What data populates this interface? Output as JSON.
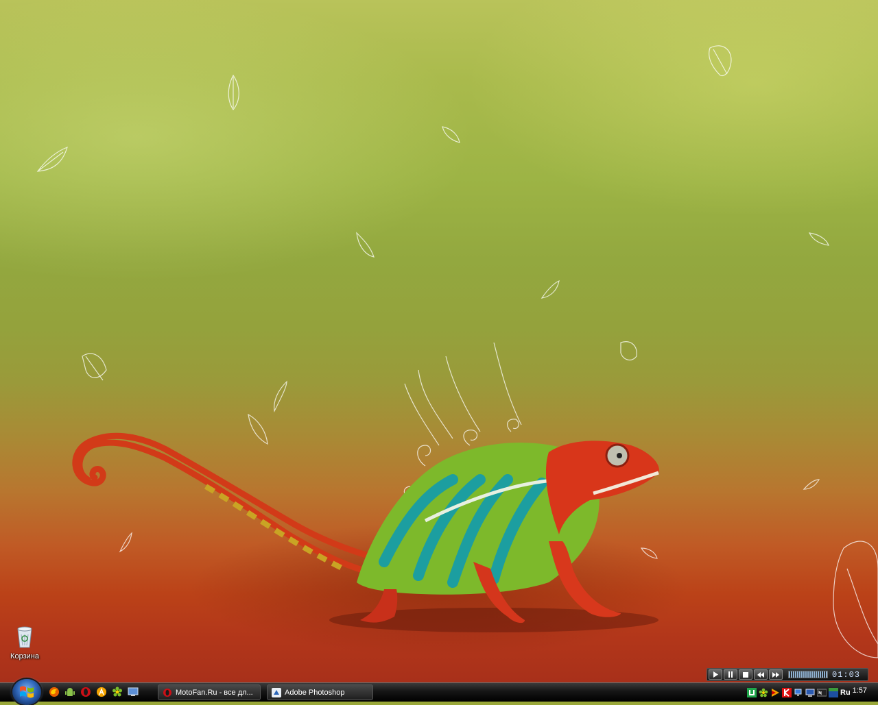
{
  "desktop": {
    "icons": [
      {
        "label": "Корзина",
        "icon": "recycle-bin-icon"
      }
    ]
  },
  "media_player": {
    "buttons": [
      "play-icon",
      "pause-icon",
      "stop-icon",
      "previous-icon",
      "next-icon"
    ],
    "time": "01:03",
    "seek_fraction": 1.0
  },
  "taskbar": {
    "start_icon": "windows-logo-icon",
    "quick_launch": [
      "firefox-icon",
      "android-icon",
      "opera-icon",
      "aimp-icon",
      "icq-icon",
      "show-desktop-icon"
    ],
    "tasks": [
      {
        "label": "MotoFan.Ru - все дл...",
        "icon": "opera-icon"
      },
      {
        "label": "Adobe Photoshop",
        "icon": "photoshop-icon"
      }
    ],
    "tray": {
      "icons": [
        "utorrent-icon",
        "icq-icon",
        "media-icon",
        "kaspersky-icon",
        "network-icon",
        "monitor-icon",
        "nero-icon",
        "3d-icon"
      ],
      "language": "Ru",
      "clock": "1:57"
    }
  }
}
